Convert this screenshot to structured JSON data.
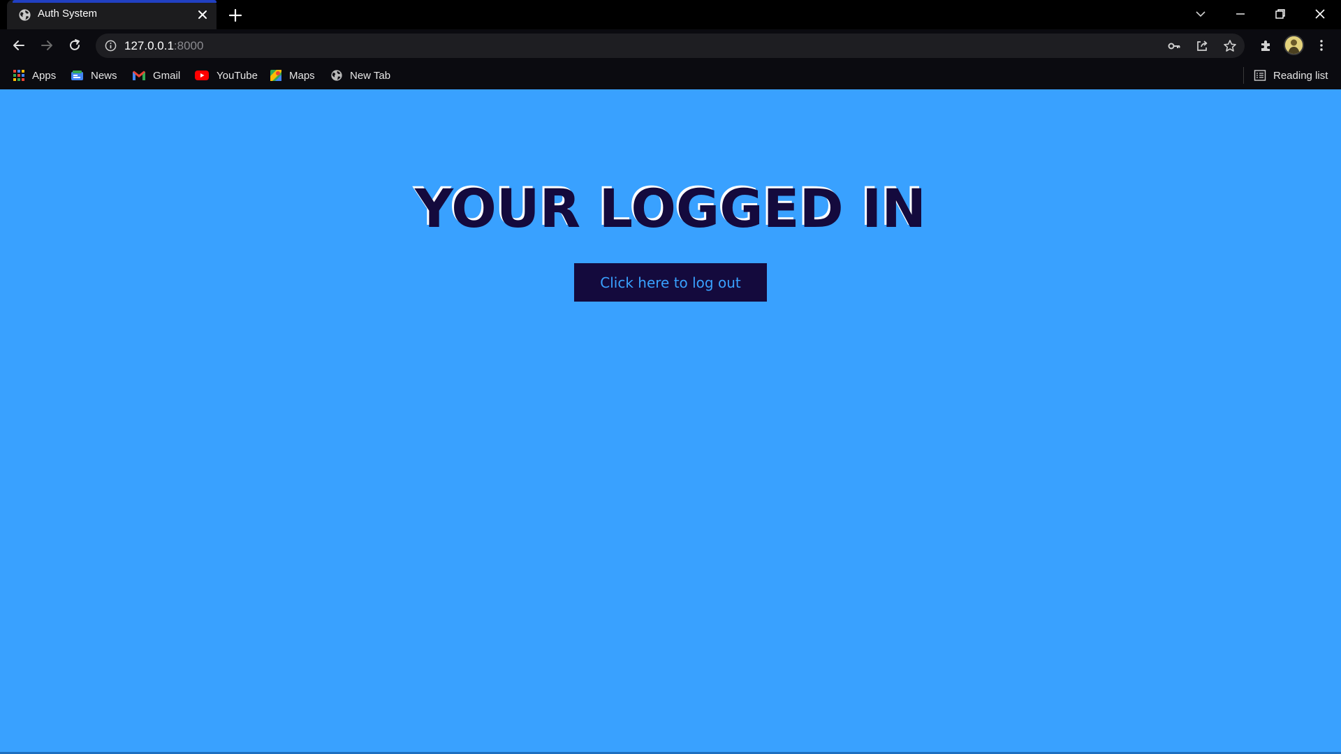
{
  "browser": {
    "tab": {
      "title": "Auth System",
      "favicon": "globe-icon"
    },
    "address": {
      "host": "127.0.0.1",
      "port": ":8000"
    },
    "bookmarks": [
      {
        "label": "Apps",
        "icon": "apps-grid-icon"
      },
      {
        "label": "News",
        "icon": "news-icon"
      },
      {
        "label": "Gmail",
        "icon": "gmail-icon"
      },
      {
        "label": "YouTube",
        "icon": "youtube-icon"
      },
      {
        "label": "Maps",
        "icon": "maps-icon"
      },
      {
        "label": "New Tab",
        "icon": "globe-icon"
      }
    ],
    "reading_list": "Reading list"
  },
  "page": {
    "headline": "YOUR LOGGED IN",
    "logout_button": "Click here to log out"
  },
  "colors": {
    "page_background": "#39a1ff",
    "headline": "#140a3d",
    "button_background": "#140a3d",
    "button_text": "#39a1ff",
    "tab_accent": "#2140c2"
  }
}
